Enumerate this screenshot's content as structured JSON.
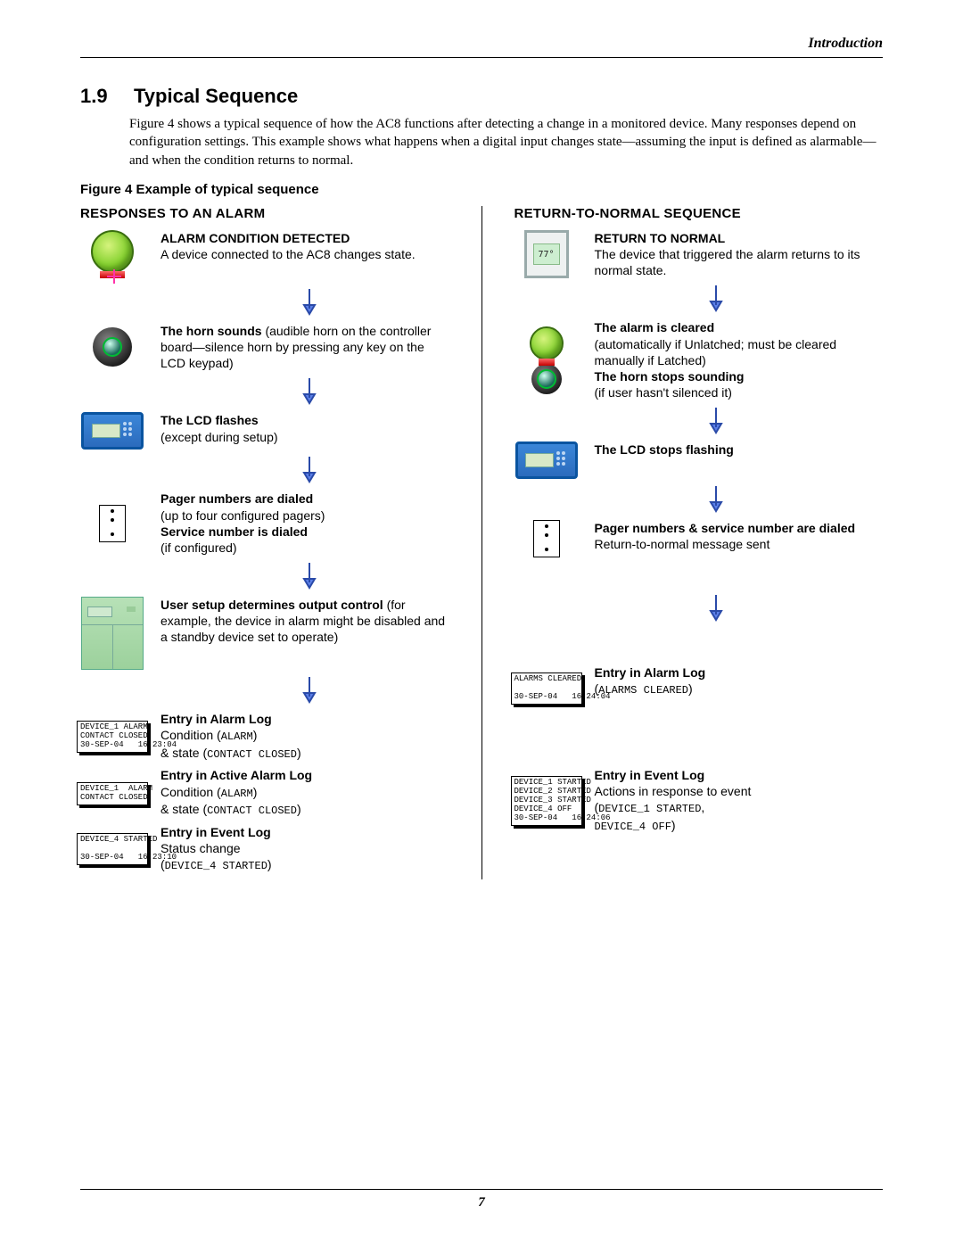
{
  "header": {
    "section": "Introduction"
  },
  "heading": {
    "num": "1.9",
    "title": "Typical Sequence"
  },
  "intro": "Figure 4 shows a typical sequence of how the AC8 functions after detecting a change in a monitored device. Many responses depend on configuration settings. This example shows what happens when a digital input changes state—assuming the input is defined as alarmable—and when the condition returns to normal.",
  "figcap": "Figure 4    Example of typical sequence",
  "left": {
    "head": "RESPONSES TO AN ALARM",
    "s1_b": "ALARM CONDITION DETECTED",
    "s1_t": "A device connected to the AC8 changes state.",
    "s2_b": "The horn sounds",
    "s2_t": " (audible horn on the controller board—silence horn by pressing any key on the LCD keypad)",
    "s3_b": "The LCD flashes",
    "s3_t": "(except during setup)",
    "s4_b1": "Pager numbers are dialed",
    "s4_t1": "(up to four configured pagers)",
    "s4_b2": "Service number is dialed",
    "s4_t2": "(if configured)",
    "s5_b": "User setup determines output control",
    "s5_t": " (for example, the device in alarm might be disabled and a standby device set to operate)",
    "log1": "DEVICE_1 ALARM\nCONTACT CLOSED\n30-SEP-04   16:23:04",
    "s6_b": "Entry in Alarm Log",
    "s6_t1": "Condition (",
    "s6_m1": "ALARM",
    "s6_t2": ")",
    "s6_t3": "& state (",
    "s6_m2": "CONTACT CLOSED",
    "s6_t4": ")",
    "log2": "DEVICE_1  ALARM\nCONTACT CLOSED",
    "s7_b": "Entry in Active Alarm Log",
    "s7_t1": "Condition (",
    "s7_m1": "ALARM",
    "s7_t2": ")",
    "s7_t3": "& state (",
    "s7_m2": "CONTACT CLOSED",
    "s7_t4": ")",
    "log3": "DEVICE_4 STARTED\n\n30-SEP-04   16:23:10",
    "s8_b": "Entry in Event Log",
    "s8_t": "Status change",
    "s8_m": "DEVICE_4 STARTED"
  },
  "right": {
    "head": "RETURN-TO-NORMAL SEQUENCE",
    "r1_b": "RETURN TO NORMAL",
    "r1_t": "The device that triggered the alarm returns to its normal state.",
    "r2_b1": "The alarm is cleared",
    "r2_t1": "(automatically if Unlatched; must be cleared manually if Latched)",
    "r2_b2": "The horn stops sounding",
    "r2_t2": "(if user hasn't silenced it)",
    "r3_b": "The LCD stops flashing",
    "r4_b": "Pager numbers & service number are dialed",
    "r4_t": "Return-to-normal message sent",
    "rlog1": "ALARMS CLEARED\n\n30-SEP-04   16:24:04",
    "r5_b": "Entry in Alarm Log",
    "r5_m": "ALARMS CLEARED",
    "rlog2": "DEVICE_1 STARTED\nDEVICE_2 STARTED\nDEVICE_3 STARTED\nDEVICE_4 OFF\n30-SEP-04   16:24:06",
    "r6_b": "Entry in Event Log",
    "r6_t": "Actions in response to event",
    "r6_m1": "DEVICE_1 STARTED",
    "r6_m2": "DEVICE_4 OFF"
  },
  "thermo_value": "77°",
  "pagenum": "7"
}
